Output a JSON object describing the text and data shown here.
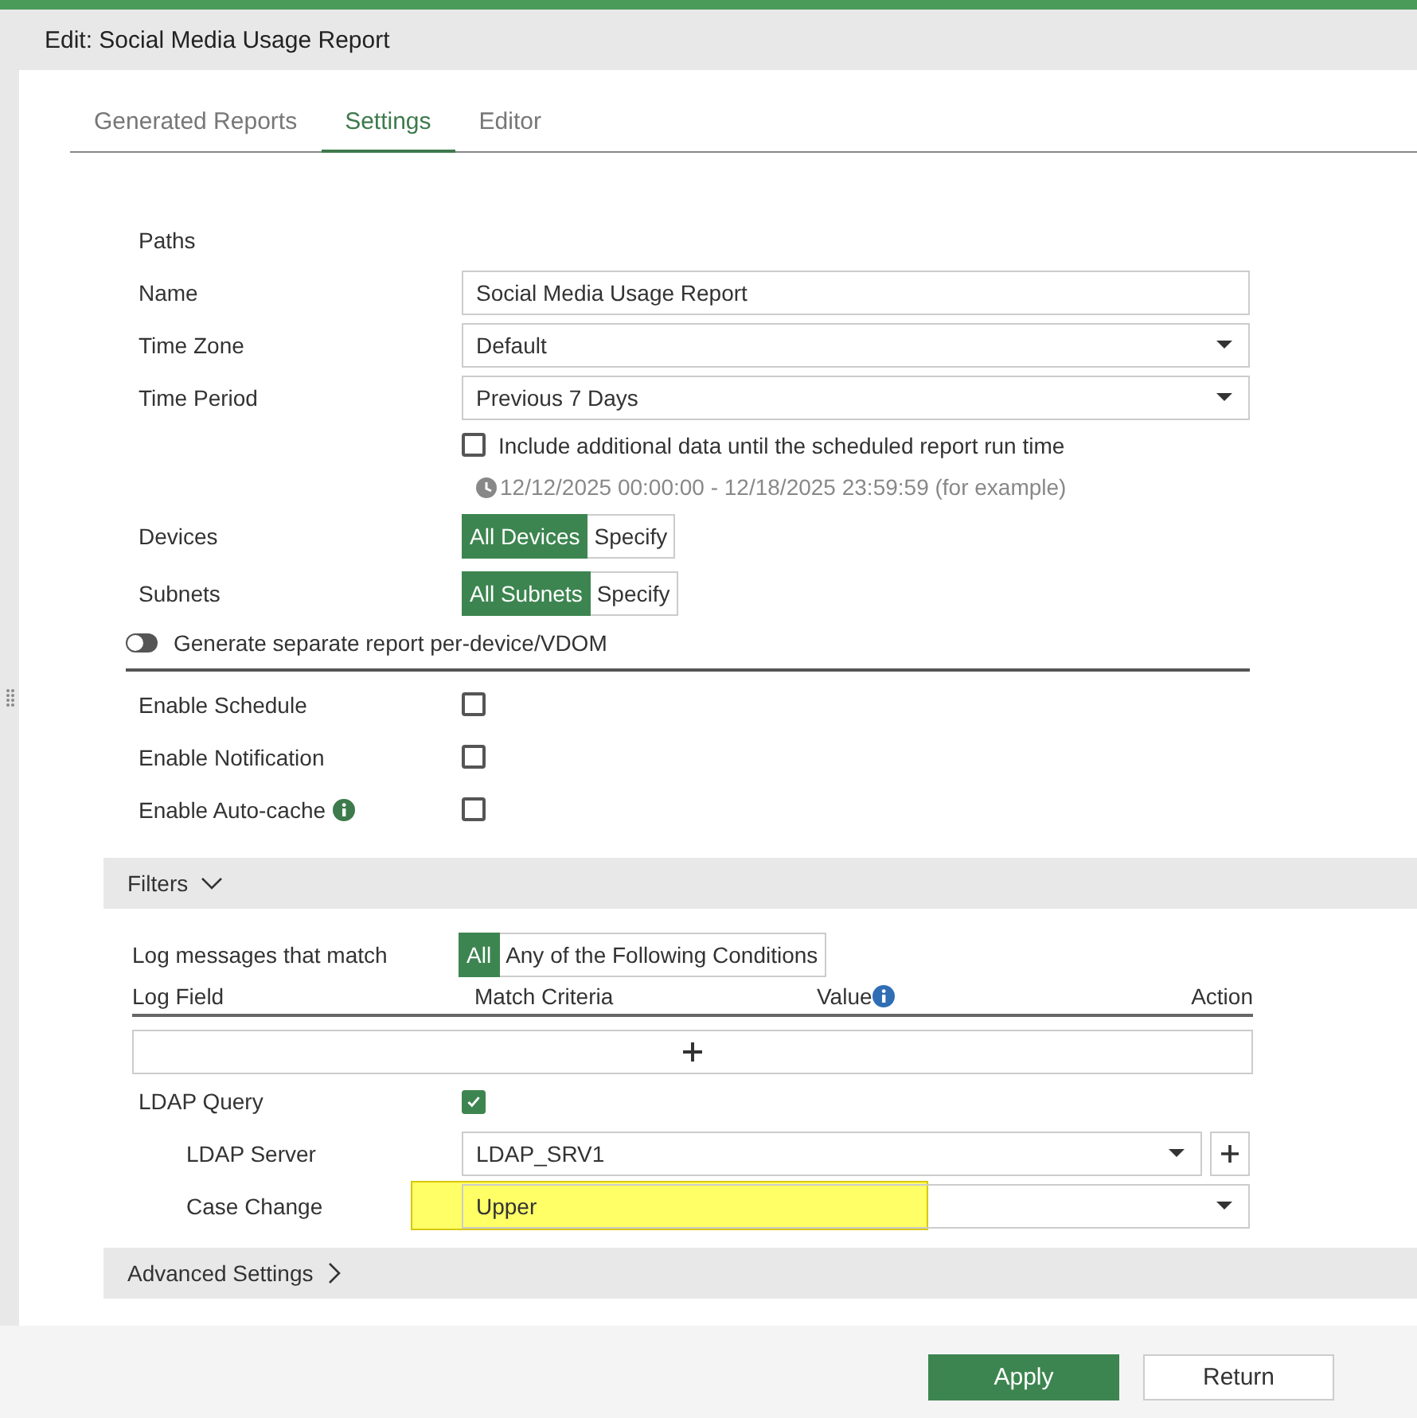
{
  "title": "Edit: Social Media Usage Report",
  "tabs": [
    {
      "label": "Generated Reports",
      "selected": false
    },
    {
      "label": "Settings",
      "selected": true
    },
    {
      "label": "Editor",
      "selected": false
    }
  ],
  "settings": {
    "paths_label": "Paths",
    "fields": [
      {
        "kind": "text",
        "label": "Name",
        "value": "Social Media Usage Report"
      },
      {
        "kind": "select",
        "label": "Time Zone",
        "value": "Default"
      },
      {
        "kind": "select",
        "label": "Time Period",
        "value": "Previous 7 Days"
      }
    ],
    "include_data": {
      "label": "Include additional data until the scheduled report run time",
      "checked": false
    },
    "example_range": "12/12/2025 00:00:00 - 12/18/2025 23:59:59 (for example)",
    "toggles": [
      {
        "label": "Devices",
        "options": [
          {
            "label": "All Devices",
            "selected": true
          },
          {
            "label": "Specify",
            "selected": false
          }
        ]
      },
      {
        "label": "Subnets",
        "options": [
          {
            "label": "All Subnets",
            "selected": true
          },
          {
            "label": "Specify",
            "selected": false
          }
        ]
      }
    ],
    "separate_report": {
      "label": "Generate separate report per-device/VDOM",
      "on": false
    },
    "checkboxes": [
      {
        "label": "Enable Schedule",
        "checked": false,
        "info": false
      },
      {
        "label": "Enable Notification",
        "checked": false,
        "info": false
      },
      {
        "label": "Enable Auto-cache",
        "checked": false,
        "info": true
      }
    ]
  },
  "filters": {
    "title": "Filters",
    "expanded": true,
    "match_label": "Log messages that match",
    "match_options": [
      {
        "label": "All",
        "selected": true
      },
      {
        "label": "Any of the Following Conditions",
        "selected": false
      }
    ],
    "columns": [
      {
        "label": "Log Field",
        "info": false
      },
      {
        "label": "Match Criteria",
        "info": false
      },
      {
        "label": "Value",
        "info": true
      },
      {
        "label": "Action",
        "info": false
      }
    ],
    "ldap_query": {
      "label": "LDAP Query",
      "checked": true
    },
    "ldap_fields": [
      {
        "label": "LDAP Server",
        "value": "LDAP_SRV1",
        "add_button": true,
        "highlighted": false
      },
      {
        "label": "Case Change",
        "value": "Upper",
        "add_button": false,
        "highlighted": true
      }
    ]
  },
  "advanced": {
    "title": "Advanced Settings",
    "expanded": false
  },
  "buttons": [
    {
      "label": "Apply",
      "kind": "primary"
    },
    {
      "label": "Return",
      "kind": "secondary"
    }
  ]
}
